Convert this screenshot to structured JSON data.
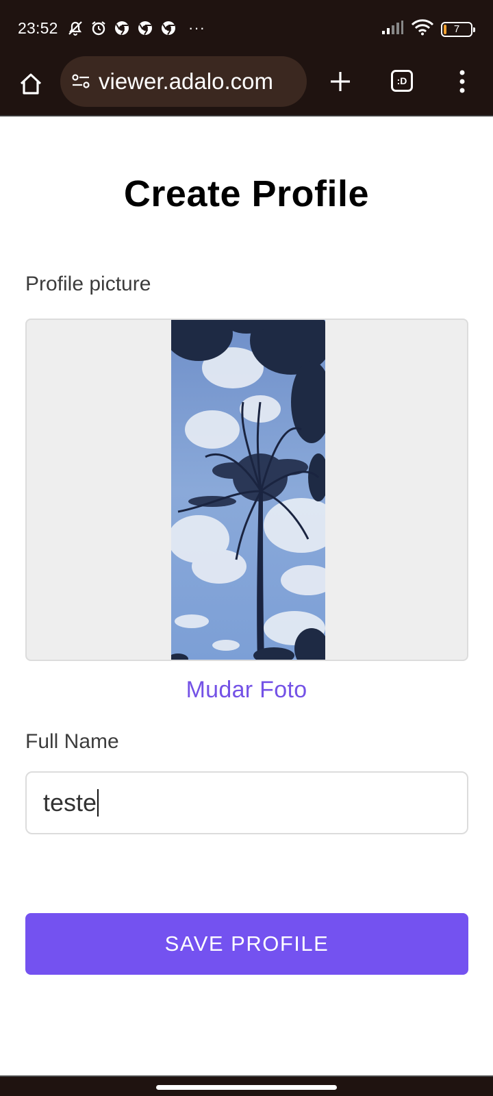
{
  "status_bar": {
    "time": "23:52",
    "battery_level": "7",
    "battery_fill_percent": 7,
    "overflow_indicator": "···",
    "icons_left": [
      "notifications-muted-icon",
      "alarm-icon",
      "chrome-icon",
      "chrome-icon",
      "chrome-icon"
    ],
    "icons_right": [
      "signal-icon",
      "wifi-icon",
      "battery-icon"
    ]
  },
  "browser": {
    "url": "viewer.adalo.com",
    "tab_count_label": ":D",
    "icons": [
      "home-icon",
      "site-settings-icon",
      "new-tab-plus-icon",
      "tabs-switcher-icon",
      "more-menu-icon"
    ]
  },
  "page": {
    "title": "Create Profile",
    "profile_picture_label": "Profile picture",
    "change_photo_label": "Mudar Foto",
    "full_name_label": "Full Name",
    "full_name_value": "teste",
    "save_button_label": "SAVE PROFILE"
  },
  "colors": {
    "accent": "#7452f0",
    "link": "#7452e6",
    "browser_chrome": "#1f1310",
    "url_pill": "#3b2820",
    "photo_frame_bg": "#eeeeee"
  }
}
